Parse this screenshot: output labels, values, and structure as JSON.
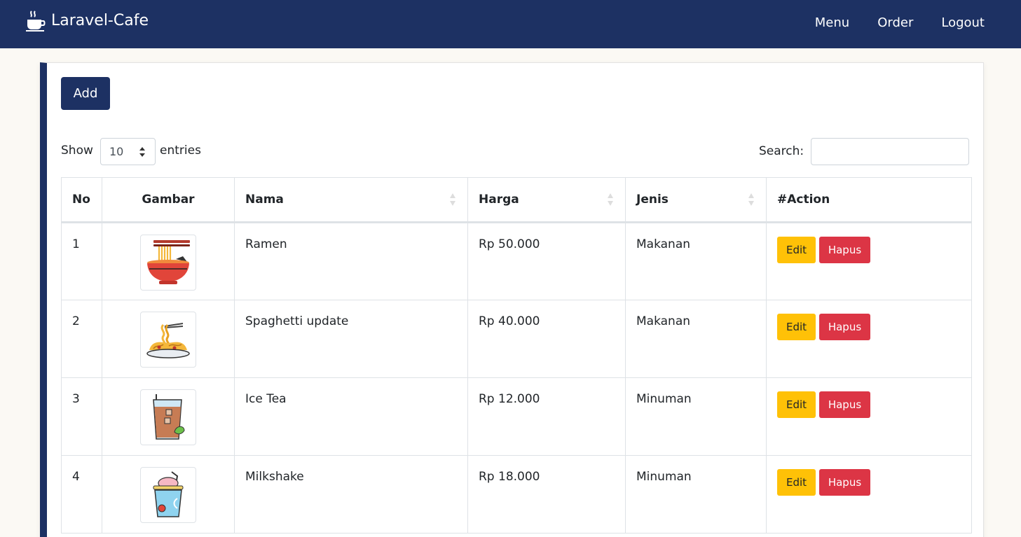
{
  "navbar": {
    "brand": "Laravel-Cafe",
    "brand_icon": "coffee-cup-icon",
    "links": [
      "Menu",
      "Order",
      "Logout"
    ]
  },
  "toolbar": {
    "add_label": "Add"
  },
  "table_controls": {
    "show_label": "Show",
    "entries_value": "10",
    "entries_label": "entries",
    "search_label": "Search:",
    "search_value": ""
  },
  "table": {
    "headers": [
      "No",
      "Gambar",
      "Nama",
      "Harga",
      "Jenis",
      "#Action"
    ],
    "rows": [
      {
        "no": "1",
        "image_icon": "ramen-icon",
        "nama": "Ramen",
        "harga": "Rp 50.000",
        "jenis": "Makanan",
        "edit": "Edit",
        "hapus": "Hapus"
      },
      {
        "no": "2",
        "image_icon": "spaghetti-icon",
        "nama": "Spaghetti update",
        "harga": "Rp 40.000",
        "jenis": "Makanan",
        "edit": "Edit",
        "hapus": "Hapus"
      },
      {
        "no": "3",
        "image_icon": "ice-tea-icon",
        "nama": "Ice Tea",
        "harga": "Rp 12.000",
        "jenis": "Minuman",
        "edit": "Edit",
        "hapus": "Hapus"
      },
      {
        "no": "4",
        "image_icon": "milkshake-icon",
        "nama": "Milkshake",
        "harga": "Rp 18.000",
        "jenis": "Minuman",
        "edit": "Edit",
        "hapus": "Hapus"
      }
    ]
  },
  "colors": {
    "navbar": "#1d3163",
    "edit_button": "#ffc107",
    "delete_button": "#dc3545",
    "page_background": "#fbf9f4"
  }
}
